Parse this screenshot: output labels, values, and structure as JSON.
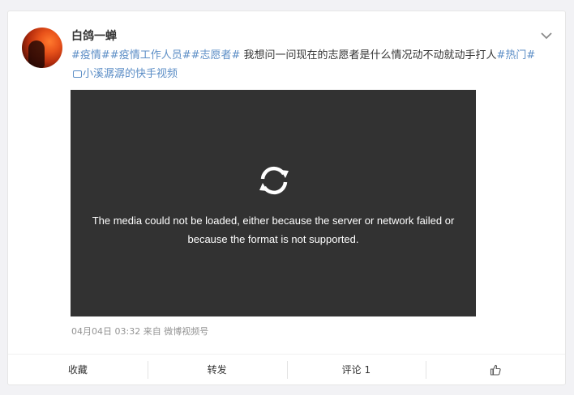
{
  "post": {
    "username": "白鸽一蝉",
    "tags": [
      "#疫情#",
      "#疫情工作人员#",
      "#志愿者#"
    ],
    "text": " 我想问一问现在的志愿者是什么情况动不动就动手打人",
    "trailing_tag": "#热门#",
    "link_text": "小溪潺潺的快手视频",
    "timestamp": "04月04日 03:32",
    "source_prefix": "来自",
    "source": "微博视频号"
  },
  "video": {
    "error_line1": "The media could not be loaded, either because the server or network failed or",
    "error_line2": "because the format is not supported."
  },
  "footer": {
    "favorite": "收藏",
    "repost": "转发",
    "comment": "评论 1",
    "like_icon": "thumbs-up-icon"
  },
  "colors": {
    "tag": "#5c8ec6",
    "video_bg": "#323232",
    "meta": "#939393"
  }
}
